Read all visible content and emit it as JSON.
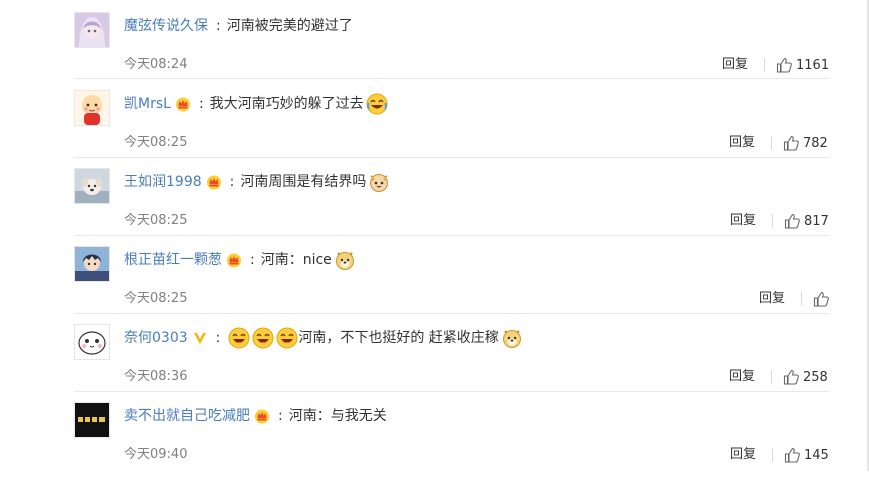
{
  "comments": [
    {
      "user": "魔弦传说久保",
      "vip": false,
      "text": "河南被完美的避过了",
      "time": "今天08:24",
      "reply": "回复",
      "likes": "1161"
    },
    {
      "user": "凯MrsL",
      "vip": true,
      "text": "我大河南巧妙的躲了过去",
      "time": "今天08:25",
      "reply": "回复",
      "likes": "782"
    },
    {
      "user": "王如润1998",
      "vip": true,
      "text": "河南周围是有结界吗",
      "time": "今天08:25",
      "reply": "回复",
      "likes": "817"
    },
    {
      "user": "根正苗红一颗葱",
      "vip": true,
      "text": "河南：nice",
      "time": "今天08:25",
      "reply": "回复",
      "likes": ""
    },
    {
      "user": "奈何0303",
      "vip": false,
      "verified": true,
      "text": "河南，不下也挺好的 赶紧收庄稼",
      "time": "今天08:36",
      "reply": "回复",
      "likes": "258"
    },
    {
      "user": "卖不出就自己吃减肥",
      "vip": true,
      "text": "河南：与我无关",
      "time": "今天09:40",
      "reply": "回复",
      "likes": "145"
    }
  ],
  "colors": {
    "username": "#4a7dbd",
    "text": "#333333",
    "time": "#808080",
    "divider": "#e8e8e8"
  },
  "icons": {
    "vip_badge": "crown-vip-icon",
    "verified": "verified-v-icon",
    "like": "thumbs-up-icon"
  }
}
